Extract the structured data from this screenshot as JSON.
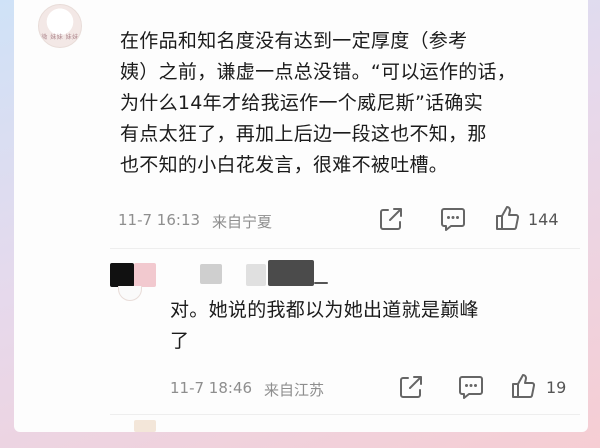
{
  "comment_main": {
    "avatar_tag": "微 妹妹 妹妹",
    "lines": [
      "在作品和知名度没有达到一定厚度（参考",
      "姨）之前，谦虚一点总没错。“可以运作的话，",
      "为什么14年才给我运作一个威尼斯”话确实",
      "有点太狂了，再加上后边一段这也不知，那",
      "也不知的小白花发言，很难不被吐槽。"
    ],
    "date": "11-7 16:13",
    "location": "来自宁夏",
    "likes": "144"
  },
  "comment_reply": {
    "lines": [
      "对。她说的我都以为她出道就是巅峰",
      "了"
    ],
    "date": "11-7 18:46",
    "location": "来自江苏",
    "likes": "19"
  },
  "colors": {
    "text": "#1b1b1b",
    "meta": "#8e8e8e",
    "icon": "#666666"
  }
}
